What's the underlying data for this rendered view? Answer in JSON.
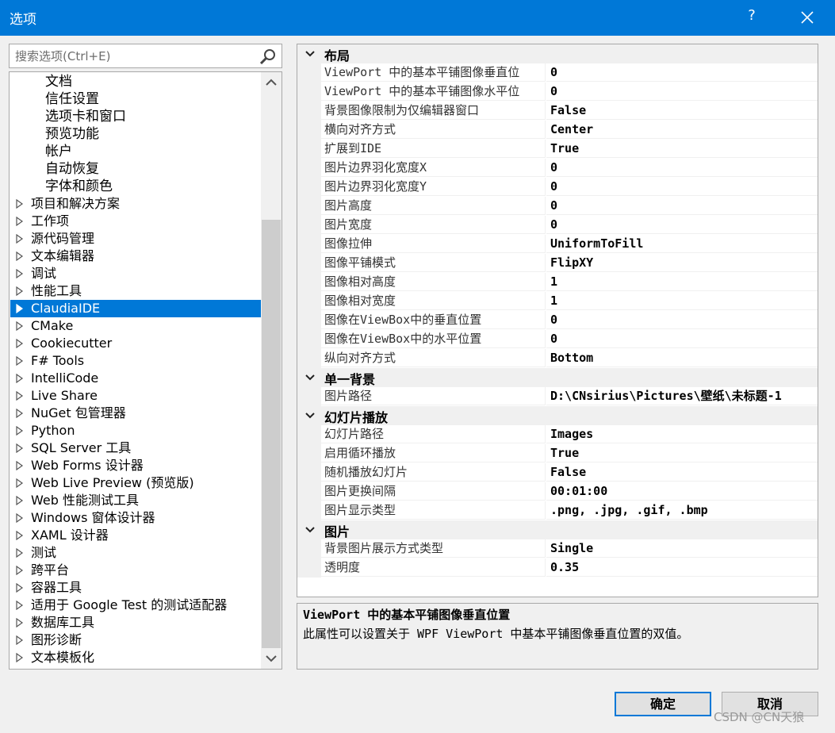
{
  "window": {
    "title": "选项",
    "help_label": "?"
  },
  "search": {
    "placeholder": "搜索选项(Ctrl+E)"
  },
  "tree": {
    "children": [
      "文档",
      "信任设置",
      "选项卡和窗口",
      "预览功能",
      "帐户",
      "自动恢复",
      "字体和颜色"
    ],
    "items": [
      "项目和解决方案",
      "工作项",
      "源代码管理",
      "文本编辑器",
      "调试",
      "性能工具",
      "ClaudiaIDE",
      "CMake",
      "Cookiecutter",
      "F# Tools",
      "IntelliCode",
      "Live Share",
      "NuGet 包管理器",
      "Python",
      "SQL Server 工具",
      "Web Forms 设计器",
      "Web Live Preview (预览版)",
      "Web 性能测试工具",
      "Windows 窗体设计器",
      "XAML 设计器",
      "测试",
      "跨平台",
      "容器工具",
      "适用于 Google Test 的测试适配器",
      "数据库工具",
      "图形诊断",
      "文本模板化"
    ],
    "selected": "ClaudiaIDE"
  },
  "properties": {
    "categories": [
      {
        "name": "布局",
        "rows": [
          {
            "name": "ViewPort 中的基本平铺图像垂直位",
            "value": "0"
          },
          {
            "name": "ViewPort 中的基本平铺图像水平位",
            "value": "0"
          },
          {
            "name": "背景图像限制为仅编辑器窗口",
            "value": "False"
          },
          {
            "name": "横向对齐方式",
            "value": "Center"
          },
          {
            "name": "扩展到IDE",
            "value": "True"
          },
          {
            "name": "图片边界羽化宽度X",
            "value": "0"
          },
          {
            "name": "图片边界羽化宽度Y",
            "value": "0"
          },
          {
            "name": "图片高度",
            "value": "0"
          },
          {
            "name": "图片宽度",
            "value": "0"
          },
          {
            "name": "图像拉伸",
            "value": "UniformToFill"
          },
          {
            "name": "图像平铺模式",
            "value": "FlipXY"
          },
          {
            "name": "图像相对高度",
            "value": "1"
          },
          {
            "name": "图像相对宽度",
            "value": "1"
          },
          {
            "name": "图像在ViewBox中的垂直位置",
            "value": "0"
          },
          {
            "name": "图像在ViewBox中的水平位置",
            "value": "0"
          },
          {
            "name": "纵向对齐方式",
            "value": "Bottom"
          }
        ]
      },
      {
        "name": "单一背景",
        "rows": [
          {
            "name": "图片路径",
            "value": "D:\\CNsirius\\Pictures\\壁纸\\未标题-1"
          }
        ]
      },
      {
        "name": "幻灯片播放",
        "rows": [
          {
            "name": "幻灯片路径",
            "value": "Images"
          },
          {
            "name": "启用循环播放",
            "value": "True"
          },
          {
            "name": "随机播放幻灯片",
            "value": "False"
          },
          {
            "name": "图片更换间隔",
            "value": "00:01:00"
          },
          {
            "name": "图片显示类型",
            "value": ".png, .jpg, .gif, .bmp"
          }
        ]
      },
      {
        "name": "图片",
        "rows": [
          {
            "name": "背景图片展示方式类型",
            "value": "Single"
          },
          {
            "name": "透明度",
            "value": "0.35"
          }
        ]
      }
    ]
  },
  "description": {
    "title": "ViewPort 中的基本平铺图像垂直位置",
    "text": "此属性可以设置关于 WPF ViewPort 中基本平铺图像垂直位置的双值。"
  },
  "buttons": {
    "ok": "确定",
    "cancel": "取消"
  },
  "watermark": "CSDN @CN天狼",
  "colors": {
    "accent": "#0078d7",
    "window_bg": "#f0f0f0"
  }
}
